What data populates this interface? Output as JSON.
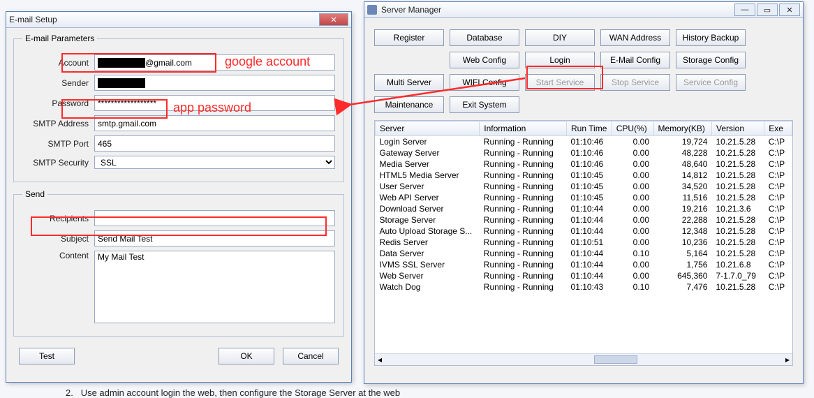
{
  "email_dialog": {
    "title": "E-mail Setup",
    "params_legend": "E-mail Parameters",
    "account_label": "Account",
    "account_value": "████████@gmail.com",
    "sender_label": "Sender",
    "sender_value": "████████",
    "password_label": "Password",
    "password_value": "******************",
    "smtp_addr_label": "SMTP Address",
    "smtp_addr_value": "smtp.gmail.com",
    "smtp_port_label": "SMTP Port",
    "smtp_port_value": "465",
    "smtp_sec_label": "SMTP Security",
    "smtp_sec_value": "SSL",
    "send_legend": "Send",
    "recipients_label": "Recipients",
    "recipients_value": "",
    "subject_label": "Subject",
    "subject_value": "Send Mail Test",
    "content_label": "Content",
    "content_value": "My Mail Test",
    "test_btn": "Test",
    "ok_btn": "OK",
    "cancel_btn": "Cancel"
  },
  "server_manager": {
    "title": "Server Manager",
    "buttons": {
      "register": "Register",
      "database": "Database",
      "diy": "DIY",
      "wan": "WAN Address",
      "history": "History Backup",
      "web": "Web Config",
      "login": "Login",
      "email": "E-Mail Config",
      "storage": "Storage Config",
      "multi": "Multi Server",
      "wifi": "WIFI Config",
      "start": "Start Service",
      "stop": "Stop Service",
      "svccfg": "Service Config",
      "maint": "Maintenance",
      "exit": "Exit System"
    },
    "columns": [
      "Server",
      "Information",
      "Run Time",
      "CPU(%)",
      "Memory(KB)",
      "Version",
      "Exe"
    ],
    "rows": [
      {
        "server": "Login Server",
        "info": "Running - Running",
        "run": "01:10:46",
        "cpu": "0.00",
        "mem": "19,724",
        "ver": "10.21.5.28",
        "exe": "C:\\P"
      },
      {
        "server": "Gateway Server",
        "info": "Running - Running",
        "run": "01:10:46",
        "cpu": "0.00",
        "mem": "48,228",
        "ver": "10.21.5.28",
        "exe": "C:\\P"
      },
      {
        "server": "Media Server",
        "info": "Running - Running",
        "run": "01:10:46",
        "cpu": "0.00",
        "mem": "48,640",
        "ver": "10.21.5.28",
        "exe": "C:\\P"
      },
      {
        "server": "HTML5 Media Server",
        "info": "Running - Running",
        "run": "01:10:45",
        "cpu": "0.00",
        "mem": "14,812",
        "ver": "10.21.5.28",
        "exe": "C:\\P"
      },
      {
        "server": "User Server",
        "info": "Running - Running",
        "run": "01:10:45",
        "cpu": "0.00",
        "mem": "34,520",
        "ver": "10.21.5.28",
        "exe": "C:\\P"
      },
      {
        "server": "Web API Server",
        "info": "Running - Running",
        "run": "01:10:45",
        "cpu": "0.00",
        "mem": "11,516",
        "ver": "10.21.5.28",
        "exe": "C:\\P"
      },
      {
        "server": "Download Server",
        "info": "Running - Running",
        "run": "01:10:44",
        "cpu": "0.00",
        "mem": "19,216",
        "ver": "10.21.3.6",
        "exe": "C:\\P"
      },
      {
        "server": "Storage Server",
        "info": "Running - Running",
        "run": "01:10:44",
        "cpu": "0.00",
        "mem": "22,288",
        "ver": "10.21.5.28",
        "exe": "C:\\P"
      },
      {
        "server": "Auto Upload Storage S...",
        "info": "Running - Running",
        "run": "01:10:44",
        "cpu": "0.00",
        "mem": "12,348",
        "ver": "10.21.5.28",
        "exe": "C:\\P"
      },
      {
        "server": "Redis Server",
        "info": "Running - Running",
        "run": "01:10:51",
        "cpu": "0.00",
        "mem": "10,236",
        "ver": "10.21.5.28",
        "exe": "C:\\P"
      },
      {
        "server": "Data Server",
        "info": "Running - Running",
        "run": "01:10:44",
        "cpu": "0.10",
        "mem": "5,164",
        "ver": "10.21.5.28",
        "exe": "C:\\P"
      },
      {
        "server": "IVMS SSL Server",
        "info": "Running - Running",
        "run": "01:10:44",
        "cpu": "0.00",
        "mem": "1,756",
        "ver": "10.21.6.8",
        "exe": "C:\\P"
      },
      {
        "server": "Web Server",
        "info": "Running - Running",
        "run": "01:10:44",
        "cpu": "0.00",
        "mem": "645,360",
        "ver": "7-1.7.0_79",
        "exe": "C:\\P"
      },
      {
        "server": "Watch Dog",
        "info": "Running - Running",
        "run": "01:10:43",
        "cpu": "0.10",
        "mem": "7,476",
        "ver": "10.21.5.28",
        "exe": "C:\\P"
      }
    ]
  },
  "annotations": {
    "google_account": "google account",
    "app_password": "app password"
  },
  "below_note_prefix": "2.",
  "below_note_text": "Use admin account login the web, then configure the Storage Server at the web"
}
